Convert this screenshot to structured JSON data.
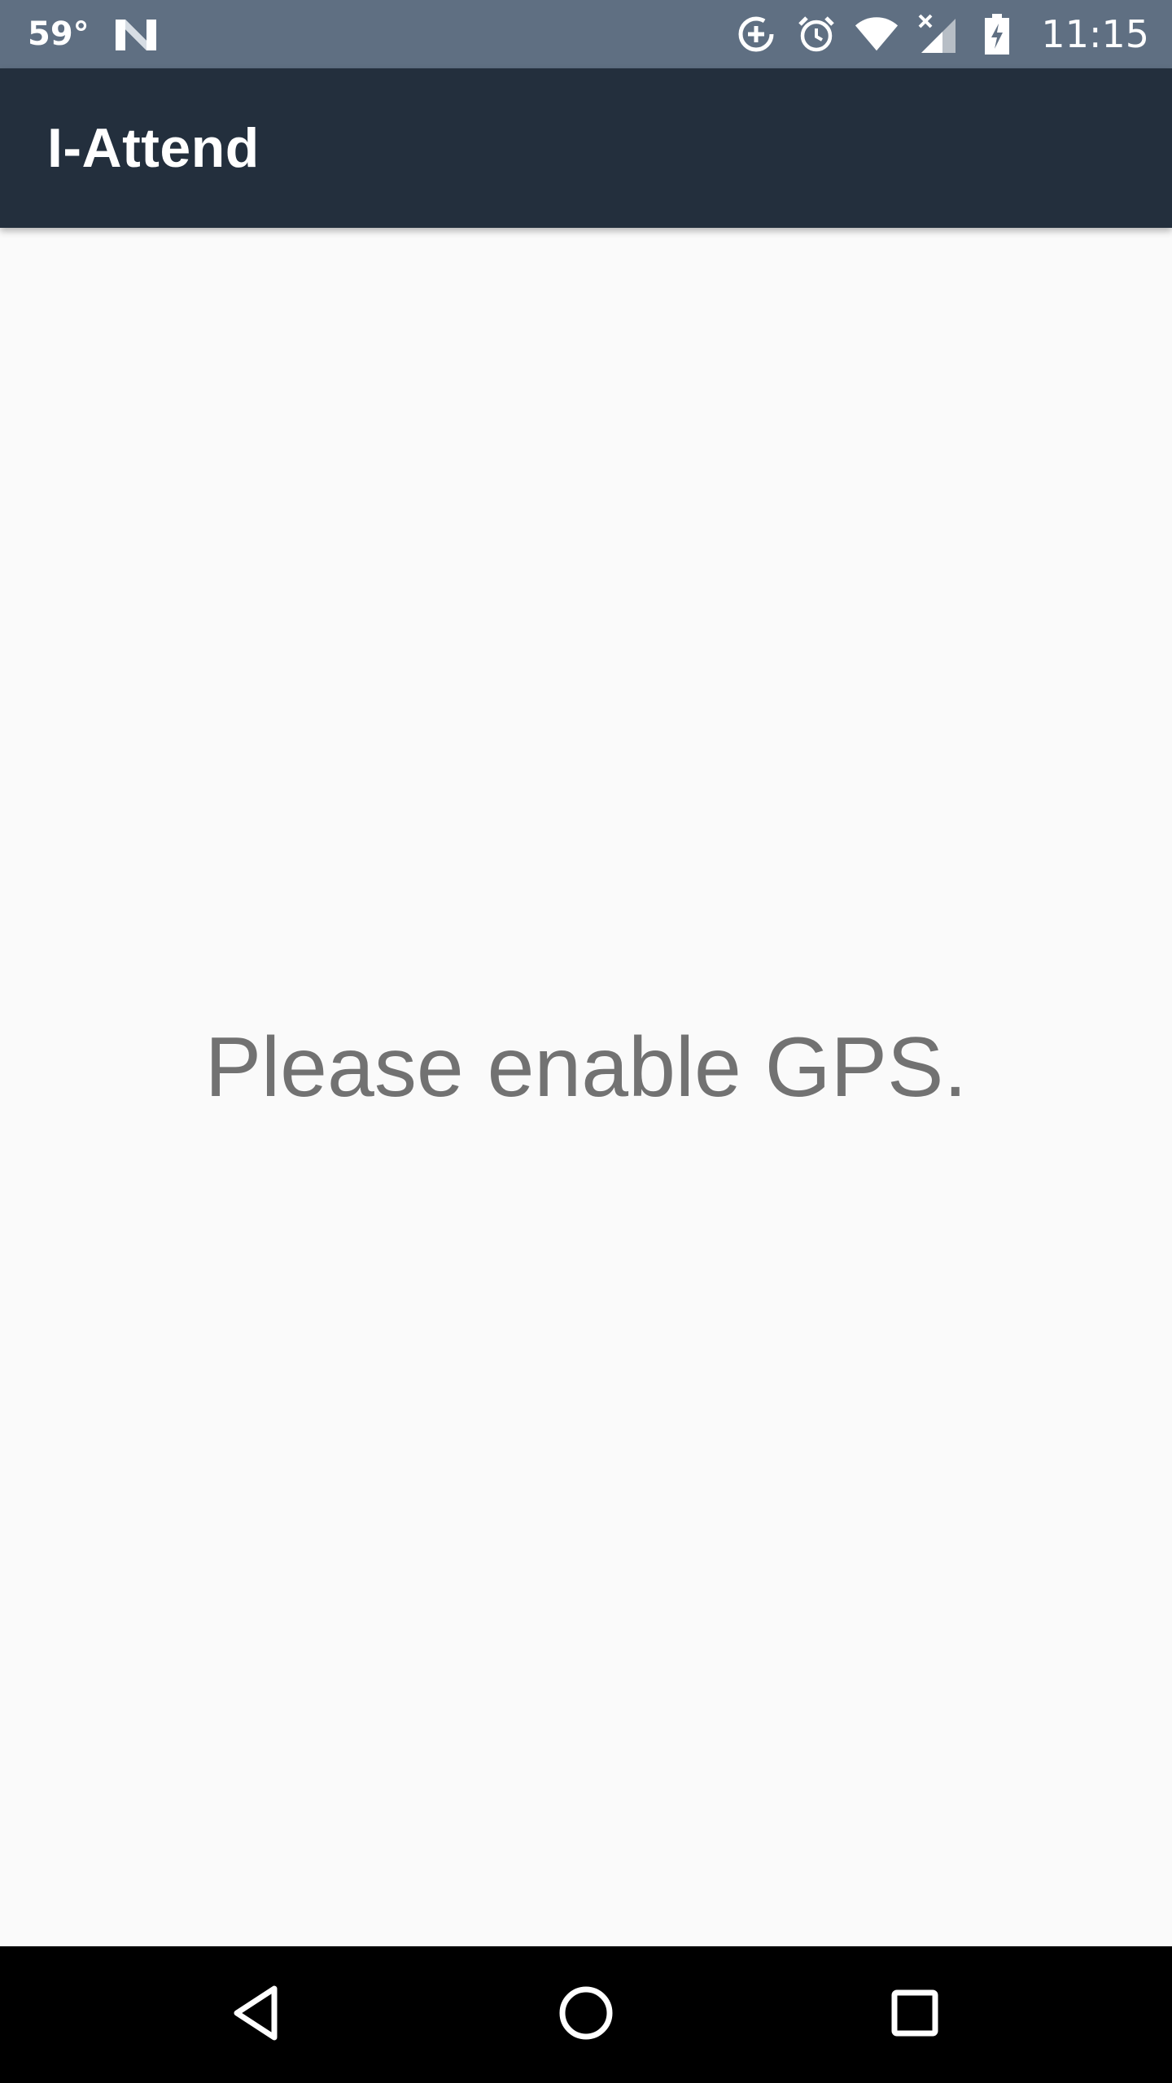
{
  "status_bar": {
    "temperature": "59°",
    "time": "11:15",
    "icons": [
      "n-icon",
      "data-saver-icon",
      "alarm-icon",
      "wifi-icon",
      "signal-no-data-icon",
      "battery-charging-icon"
    ]
  },
  "app_bar": {
    "title": "I-Attend"
  },
  "main": {
    "message": "Please enable GPS."
  },
  "nav_bar": {
    "icons": [
      "back-icon",
      "home-icon",
      "recents-icon"
    ]
  },
  "colors": {
    "status_bar": "#5f6f82",
    "app_bar": "#232f3d",
    "background": "#fafafa",
    "message_text": "#727272",
    "nav_bar": "#000000"
  }
}
